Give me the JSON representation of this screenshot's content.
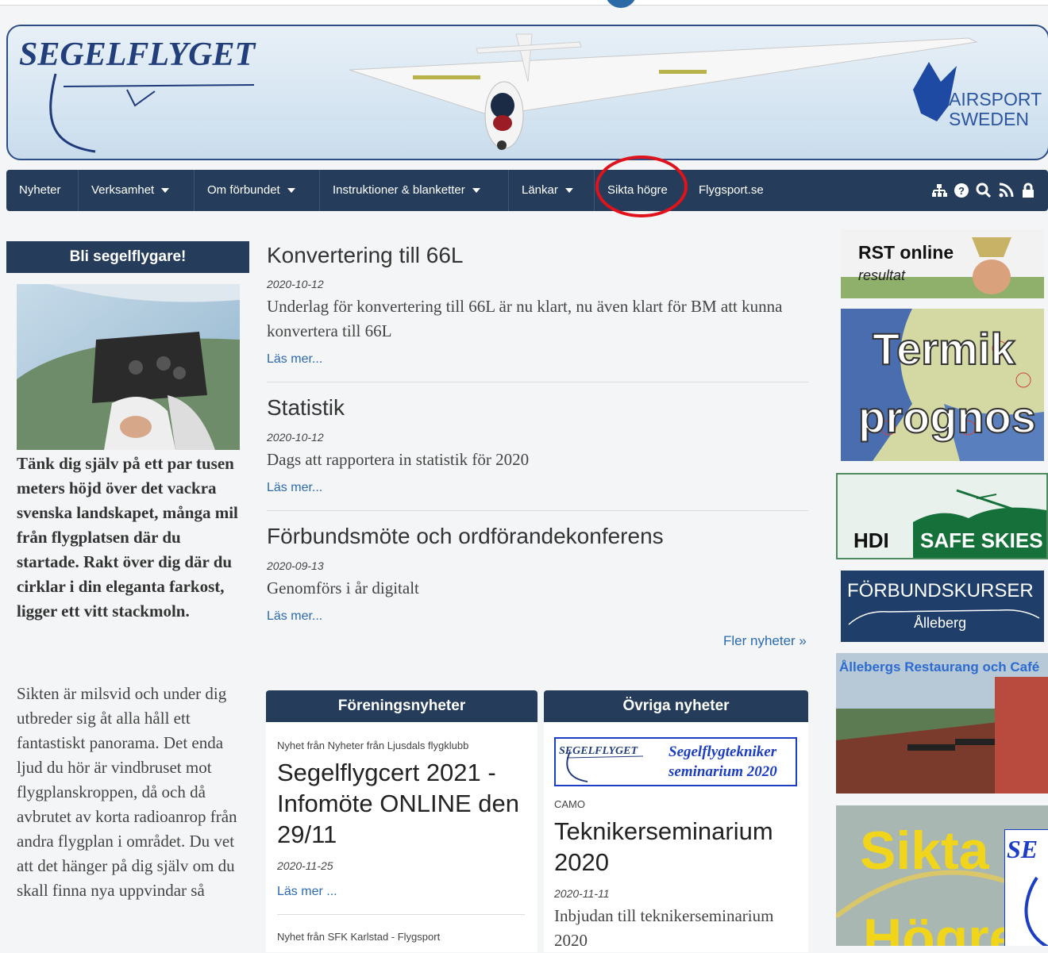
{
  "banner": {
    "logo_text": "SEGELFLYGET",
    "airsport_line1": "AIRSPORT",
    "airsport_line2": "SWEDEN"
  },
  "nav": {
    "items": [
      {
        "label": "Nyheter"
      },
      {
        "label": "Verksamhet"
      },
      {
        "label": "Om förbundet"
      },
      {
        "label": "Instruktioner & blanketter"
      },
      {
        "label": "Länkar"
      },
      {
        "label": "Sikta högre"
      },
      {
        "label": "Flygsport.se"
      }
    ],
    "icons": [
      "sitemap-icon",
      "help-icon",
      "search-icon",
      "rss-icon",
      "lock-icon"
    ]
  },
  "sidebar": {
    "heading": "Bli segelflygare!",
    "bold_text": "Tänk dig själv på ett par tusen meters höjd över det vackra svenska landskapet, många mil från flygplatsen där du startade. Rakt över dig där du cirklar i din eleganta farkost, ligger ett vitt stackmoln.",
    "body_text": "Sikten är milsvid och under dig utbreder sig åt alla håll ett fantastiskt panorama. Det enda ljud du hör är vindbruset mot flygplanskroppen, då och då avbrutet av korta radioanrop från andra flygplan i området. Du vet att det hänger på dig själv om du skall finna nya uppvindar så"
  },
  "articles": [
    {
      "title": "Konvertering till 66L",
      "date": "2020-10-12",
      "body": "Underlag för konvertering till 66L är nu klart, nu även klart för BM att kunna konvertera till 66L",
      "more": "Läs mer..."
    },
    {
      "title": "Statistik",
      "date": "2020-10-12",
      "body": "Dags att rapportera in statistik för 2020",
      "more": "Läs mer..."
    },
    {
      "title": "Förbundsmöte och ordförandekonferens",
      "date": "2020-09-13",
      "body": "Genomförs i år digitalt",
      "more": "Läs mer..."
    }
  ],
  "more_news": "Fler nyheter »",
  "club_news": {
    "heading": "Föreningsnyheter",
    "item1_source": "Nyhet från Nyheter från Ljusdals flygklubb",
    "item1_title": "Segelflygcert 2021 - Infomöte ONLINE den 29/11",
    "item1_date": "2020-11-25",
    "item1_more": "Läs mer ...",
    "item2_source": "Nyhet från SFK Karlstad - Flygsport"
  },
  "other_news": {
    "heading": "Övriga nyheter",
    "banner_logo": "SEGELFLYGET",
    "banner_line1": "Segelflygtekniker",
    "banner_line2": "seminarium 2020",
    "category": "CAMO",
    "title": "Teknikerseminarium 2020",
    "date": "2020-11-11",
    "body": "Inbjudan till teknikerseminarium 2020"
  },
  "ads": {
    "rst_title": "RST online",
    "rst_sub": "resultat",
    "termik_line1": "Termik",
    "termik_line2": "prognos",
    "hdi_left": "HDI",
    "hdi_right": "SAFE SKIES",
    "kurser_title": "FÖRBUNDSKURSER",
    "kurser_sub": "Ålleberg",
    "restaurang": "Ållebergs Restaurang och Café",
    "sikta_line1": "Sikta",
    "sikta_line2": "Högre",
    "sikta_logo": "SE"
  }
}
